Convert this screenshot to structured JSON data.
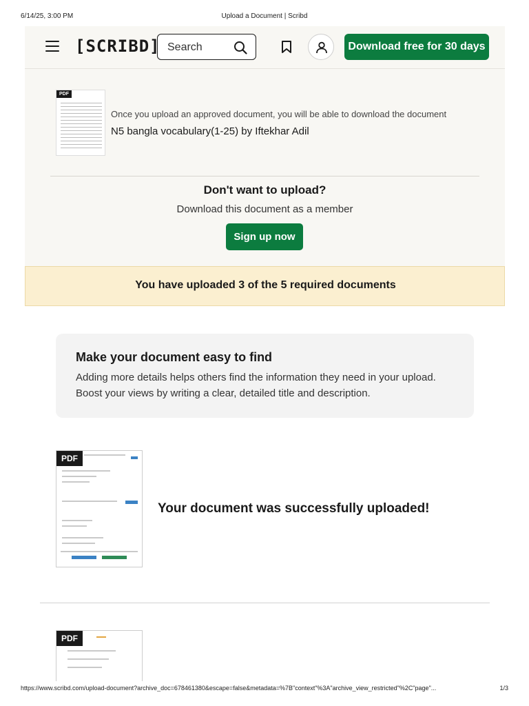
{
  "print": {
    "datetime": "6/14/25, 3:00 PM",
    "title": "Upload a Document | Scribd",
    "url": "https://www.scribd.com/upload-document?archive_doc=678461380&escape=false&metadata=%7B\"context\"%3A\"archive_view_restricted\"%2C\"page\"...",
    "page_number": "1/3"
  },
  "header": {
    "logo": "[SCRIBD]",
    "search_placeholder": "Search",
    "download_button": "Download free for 30 days"
  },
  "upload": {
    "pdf_label": "PDF",
    "message": "Once you upload an approved document, you will be able to download the document",
    "document_title": "N5 bangla vocabulary(1-25) by Iftekhar Adil",
    "dont_want_heading": "Don't want to upload?",
    "member_text": "Download this document as a member",
    "signup_button": "Sign up now"
  },
  "progress": {
    "text": "You have uploaded 3 of the 5 required documents",
    "uploaded": 3,
    "required": 5
  },
  "tip": {
    "title": "Make your document easy to find",
    "line1": "Adding more details helps others find the information they need in your upload.",
    "line2": "Boost your views by writing a clear, detailed title and description."
  },
  "uploaded_docs": [
    {
      "pdf_label": "PDF",
      "status": "Your document was successfully uploaded!"
    },
    {
      "pdf_label": "PDF"
    }
  ],
  "colors": {
    "brand_green": "#0c7c3f",
    "banner_bg": "#fbefd0",
    "header_bg": "#f8f7f3"
  }
}
